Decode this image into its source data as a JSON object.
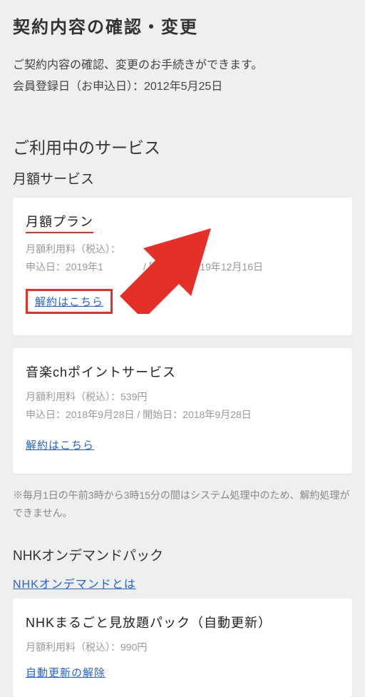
{
  "header": {
    "title": "契約内容の確認・変更",
    "intro_line1": "ご契約内容の確認、変更のお手続きができます。",
    "intro_line2": "会員登録日（お申込日）：2012年5月25日"
  },
  "section": {
    "title": "ご利用中のサービス",
    "monthly_subtitle": "月額サービス"
  },
  "cards": {
    "plan1": {
      "title": "月額プラン",
      "fee_label": "月額利用料（税込）：",
      "date_line": "申込日：2019年1　　　　/ 開始日：2019年12月16日",
      "cancel_label": "解約はこちら"
    },
    "plan2": {
      "title": "音楽chポイントサービス",
      "fee_line": "月額利用料（税込）：539円",
      "date_line": "申込日：2018年9月28日 / 開始日：2018年9月28日",
      "cancel_label": "解約はこちら"
    }
  },
  "note": "※毎月1日の午前3時から3時15分の間はシステム処理中のため、解約処理ができません。",
  "nhk": {
    "subtitle": "NHKオンデマンドパック",
    "info_link": "NHKオンデマンドとは",
    "card": {
      "title": "NHKまるごと見放題パック（自動更新）",
      "fee_line": "月額利用料（税込）：990円",
      "cancel_label": "自動更新の解除"
    }
  }
}
